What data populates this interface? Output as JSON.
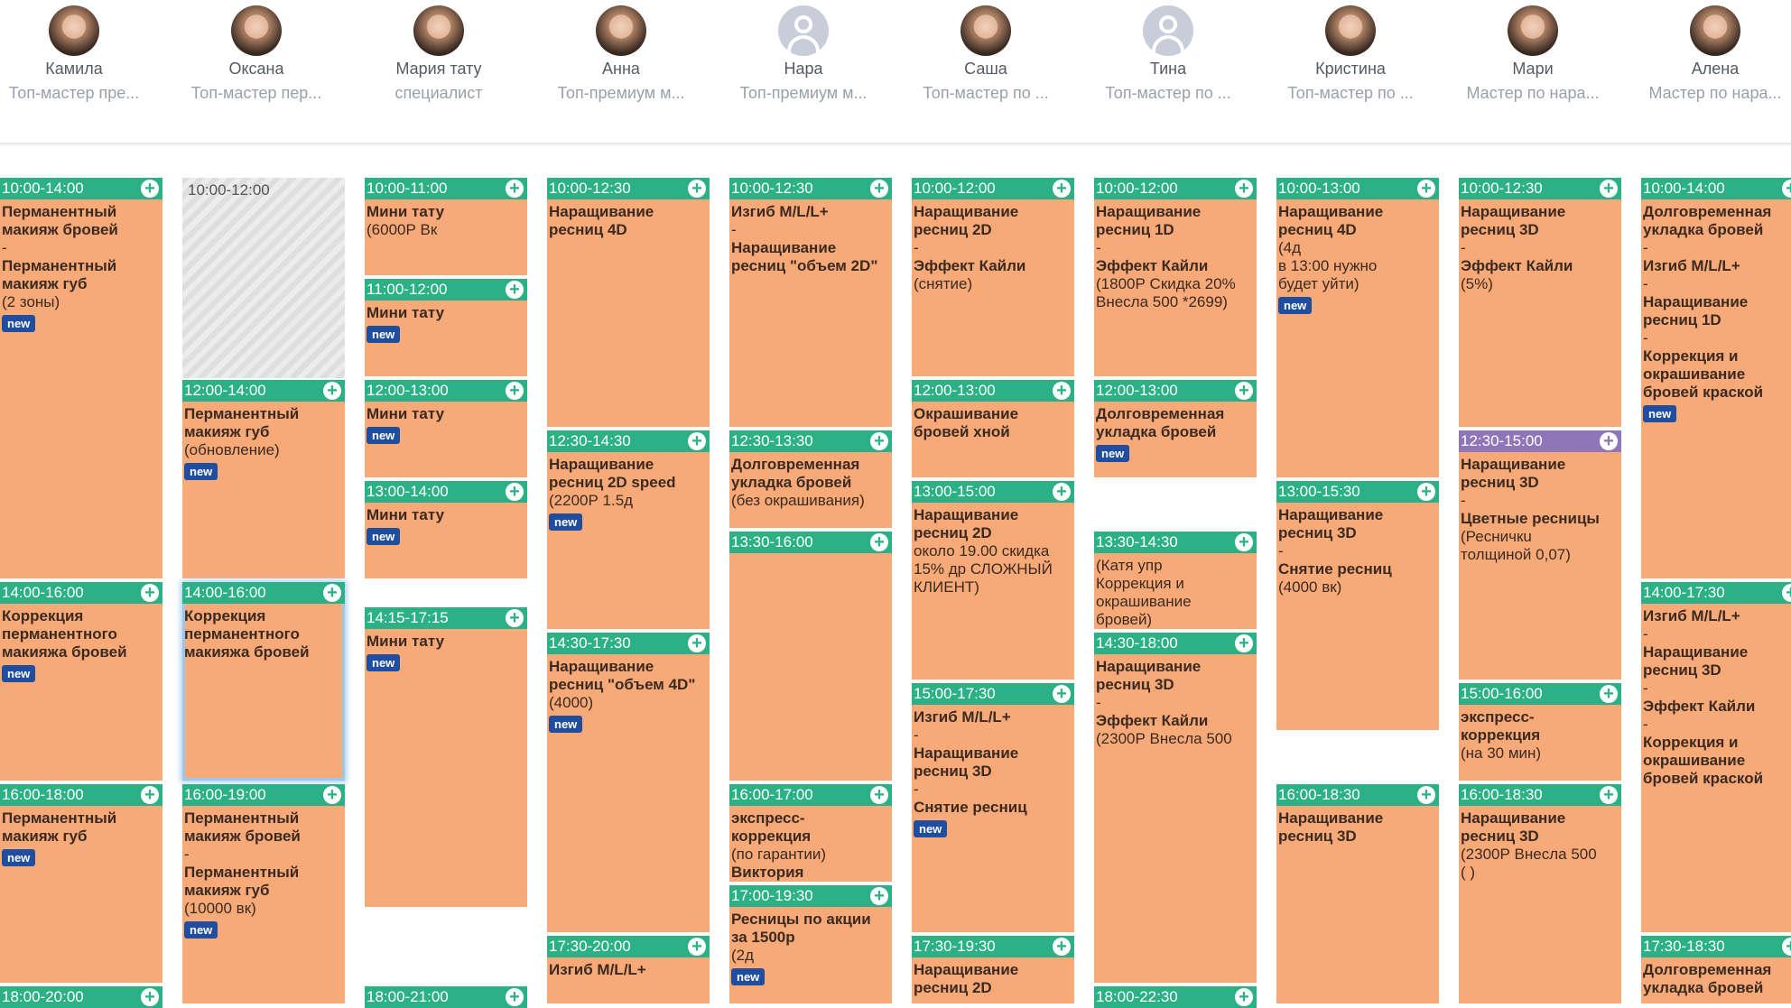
{
  "staff": [
    {
      "name": "Камила",
      "role": "Топ-мастер пре...",
      "avatar": "photo"
    },
    {
      "name": "Оксана",
      "role": "Топ-мастер пер...",
      "avatar": "photo"
    },
    {
      "name": "Мария тату",
      "role": "специалист",
      "avatar": "photo"
    },
    {
      "name": "Анна",
      "role": "Топ-премиум м...",
      "avatar": "photo"
    },
    {
      "name": "Нара",
      "role": "Топ-премиум м...",
      "avatar": "placeholder"
    },
    {
      "name": "Саша",
      "role": "Топ-мастер по ...",
      "avatar": "photo"
    },
    {
      "name": "Тина",
      "role": "Топ-мастер по ...",
      "avatar": "placeholder"
    },
    {
      "name": "Кристина",
      "role": "Топ-мастер по ...",
      "avatar": "photo"
    },
    {
      "name": "Мари",
      "role": "Мастер по нара...",
      "avatar": "photo"
    },
    {
      "name": "Алена",
      "role": "Мастер по нара...",
      "avatar": "photo"
    }
  ],
  "new_label": "new",
  "add_symbol": "+",
  "blank_slot": {
    "col": 1,
    "time": "10:00-12:00"
  },
  "appointments": [
    {
      "col": 0,
      "time": "10:00-14:00",
      "lines": [
        [
          "Перманентный",
          "b"
        ],
        [
          "макияж бровей",
          "b"
        ],
        [
          "-",
          ""
        ],
        [
          "Перманентный",
          "b"
        ],
        [
          "макияж губ",
          "b"
        ],
        [
          "(2 зоны)",
          ""
        ]
      ],
      "new": true
    },
    {
      "col": 0,
      "time": "14:00-16:00",
      "lines": [
        [
          "Коррекция",
          "b"
        ],
        [
          "перманентного",
          "b"
        ],
        [
          "макияжа бровей",
          "b"
        ]
      ],
      "new": true
    },
    {
      "col": 0,
      "time": "16:00-18:00",
      "lines": [
        [
          "Перманентный",
          "b"
        ],
        [
          "макияж губ",
          "b"
        ]
      ],
      "new": true
    },
    {
      "col": 0,
      "time": "18:00-20:00",
      "lines": [],
      "new": false
    },
    {
      "col": 1,
      "time": "12:00-14:00",
      "lines": [
        [
          "Перманентный",
          "b"
        ],
        [
          "макияж губ",
          "b"
        ],
        [
          "(обновление)",
          ""
        ]
      ],
      "new": true
    },
    {
      "col": 1,
      "time": "14:00-16:00",
      "lines": [
        [
          "Коррекция",
          "b"
        ],
        [
          "перманентного",
          "b"
        ],
        [
          "макияжа бровей",
          "b"
        ]
      ],
      "new": false,
      "selected": true
    },
    {
      "col": 1,
      "time": "16:00-19:00",
      "lines": [
        [
          "Перманентный",
          "b"
        ],
        [
          "макияж бровей",
          "b"
        ],
        [
          "-",
          ""
        ],
        [
          "Перманентный",
          "b"
        ],
        [
          "макияж губ",
          "b"
        ],
        [
          "(10000 вк)",
          ""
        ]
      ],
      "new": true
    },
    {
      "col": 2,
      "time": "10:00-11:00",
      "lines": [
        [
          "Мини тату",
          "b"
        ],
        [
          "(6000Р Вк",
          ""
        ]
      ],
      "new": false
    },
    {
      "col": 2,
      "time": "11:00-12:00",
      "lines": [
        [
          "Мини тату",
          "b"
        ]
      ],
      "new": true
    },
    {
      "col": 2,
      "time": "12:00-13:00",
      "lines": [
        [
          "Мини тату",
          "b"
        ]
      ],
      "new": true
    },
    {
      "col": 2,
      "time": "13:00-14:00",
      "lines": [
        [
          "Мини тату",
          "b"
        ]
      ],
      "new": true
    },
    {
      "col": 2,
      "time": "14:15-17:15",
      "lines": [
        [
          "Мини тату",
          "b"
        ]
      ],
      "new": true
    },
    {
      "col": 2,
      "time": "18:00-21:00",
      "lines": [],
      "new": false
    },
    {
      "col": 3,
      "time": "10:00-12:30",
      "lines": [
        [
          "Наращивание",
          "b"
        ],
        [
          "ресниц 4D",
          "b"
        ]
      ],
      "new": false
    },
    {
      "col": 3,
      "time": "12:30-14:30",
      "lines": [
        [
          "Наращивание",
          "b"
        ],
        [
          "ресниц 2D speed",
          "b"
        ],
        [
          "(2200Р 1.5д",
          ""
        ]
      ],
      "new": true
    },
    {
      "col": 3,
      "time": "14:30-17:30",
      "lines": [
        [
          "Наращивание",
          "b"
        ],
        [
          "ресниц \"объем 4D\"",
          "b"
        ],
        [
          "(4000)",
          ""
        ]
      ],
      "new": true
    },
    {
      "col": 3,
      "time": "17:30-20:00",
      "lines": [
        [
          "Изгиб M/L/L+",
          "b"
        ]
      ],
      "new": false
    },
    {
      "col": 4,
      "time": "10:00-12:30",
      "lines": [
        [
          "Изгиб M/L/L+",
          "b"
        ],
        [
          "-",
          ""
        ],
        [
          "Наращивание",
          "b"
        ],
        [
          "ресниц \"объем 2D\"",
          "b"
        ]
      ],
      "new": false
    },
    {
      "col": 4,
      "time": "12:30-13:30",
      "lines": [
        [
          "Долговременная",
          "b"
        ],
        [
          "укладка бровей",
          "b"
        ],
        [
          "(без окрашивания)",
          ""
        ]
      ],
      "new": false
    },
    {
      "col": 4,
      "time": "13:30-16:00",
      "lines": [],
      "new": false
    },
    {
      "col": 4,
      "time": "16:00-17:00",
      "lines": [
        [
          "экспресс-",
          "b"
        ],
        [
          "коррекция",
          "b"
        ],
        [
          "(по гарантии)",
          ""
        ],
        [
          "Виктория",
          "b"
        ]
      ],
      "new": false
    },
    {
      "col": 4,
      "time": "17:00-19:30",
      "lines": [
        [
          "Ресницы по акции",
          "b"
        ],
        [
          "за 1500р",
          "b"
        ],
        [
          "(2д",
          ""
        ]
      ],
      "new": true
    },
    {
      "col": 5,
      "time": "10:00-12:00",
      "lines": [
        [
          "Наращивание",
          "b"
        ],
        [
          "ресниц 2D",
          "b"
        ],
        [
          "-",
          ""
        ],
        [
          "Эффект Кайли",
          "b"
        ],
        [
          "(снятие)",
          ""
        ]
      ],
      "new": false
    },
    {
      "col": 5,
      "time": "12:00-13:00",
      "lines": [
        [
          "Окрашивание",
          "b"
        ],
        [
          "бровей хной",
          "b"
        ]
      ],
      "new": false
    },
    {
      "col": 5,
      "time": "13:00-15:00",
      "lines": [
        [
          "Наращивание",
          "b"
        ],
        [
          "ресниц 2D",
          "b"
        ],
        [
          " ",
          ""
        ],
        [
          "около 19.00 скидка",
          ""
        ],
        [
          "15% др СЛОЖНЫЙ",
          ""
        ],
        [
          "КЛИЕНТ)",
          ""
        ]
      ],
      "new": false
    },
    {
      "col": 5,
      "time": "15:00-17:30",
      "lines": [
        [
          "Изгиб M/L/L+",
          "b"
        ],
        [
          "-",
          ""
        ],
        [
          "Наращивание",
          "b"
        ],
        [
          "ресниц 3D",
          "b"
        ],
        [
          "-",
          ""
        ],
        [
          "Снятие ресниц",
          "b"
        ]
      ],
      "new": true
    },
    {
      "col": 5,
      "time": "17:30-19:30",
      "lines": [
        [
          "Наращивание",
          "b"
        ],
        [
          "ресниц 2D",
          "b"
        ]
      ],
      "new": false
    },
    {
      "col": 6,
      "time": "10:00-12:00",
      "lines": [
        [
          "Наращивание",
          "b"
        ],
        [
          "ресниц 1D",
          "b"
        ],
        [
          "-",
          ""
        ],
        [
          "Эффект Кайли",
          "b"
        ],
        [
          "(1800Р Скидка 20%",
          ""
        ],
        [
          " ",
          ""
        ],
        [
          "Внесла 500 *2699)",
          ""
        ]
      ],
      "new": false
    },
    {
      "col": 6,
      "time": "12:00-13:00",
      "lines": [
        [
          "Долговременная",
          "b"
        ],
        [
          "укладка бровей",
          "b"
        ]
      ],
      "new": true
    },
    {
      "col": 6,
      "time": "13:30-14:30",
      "lines": [
        [
          "(Катя упр",
          ""
        ],
        [
          "Коррекция и",
          ""
        ],
        [
          "окрашивание",
          ""
        ],
        [
          "бровей)",
          ""
        ]
      ],
      "new": false
    },
    {
      "col": 6,
      "time": "14:30-18:00",
      "lines": [
        [
          "Наращивание",
          "b"
        ],
        [
          "ресниц 3D",
          "b"
        ],
        [
          "-",
          ""
        ],
        [
          "Эффект Кайли",
          "b"
        ],
        [
          "(2300Р Внесла 500",
          ""
        ]
      ],
      "new": false
    },
    {
      "col": 6,
      "time": "18:00-22:30",
      "lines": [],
      "new": false
    },
    {
      "col": 7,
      "time": "10:00-13:00",
      "lines": [
        [
          "Наращивание",
          "b"
        ],
        [
          "ресниц 4D",
          "b"
        ],
        [
          "(4д",
          ""
        ],
        [
          " ",
          ""
        ],
        [
          "в 13:00 нужно",
          ""
        ],
        [
          "будет уйти)",
          ""
        ]
      ],
      "new": true
    },
    {
      "col": 7,
      "time": "13:00-15:30",
      "lines": [
        [
          "Наращивание",
          "b"
        ],
        [
          "ресниц 3D",
          "b"
        ],
        [
          "-",
          ""
        ],
        [
          "Снятие ресниц",
          "b"
        ],
        [
          "(4000 вк)",
          ""
        ]
      ],
      "new": false
    },
    {
      "col": 7,
      "time": "16:00-18:30",
      "lines": [
        [
          "Наращивание",
          "b"
        ],
        [
          "ресниц 3D",
          "b"
        ]
      ],
      "new": false
    },
    {
      "col": 8,
      "time": "10:00-12:30",
      "lines": [
        [
          "Наращивание",
          "b"
        ],
        [
          "ресниц 3D",
          "b"
        ],
        [
          "-",
          ""
        ],
        [
          "Эффект Кайли",
          "b"
        ],
        [
          "(5%)",
          ""
        ]
      ],
      "new": false
    },
    {
      "col": 8,
      "time": "12:30-15:00",
      "lines": [
        [
          "Наращивание",
          "b"
        ],
        [
          "ресниц 3D",
          "b"
        ],
        [
          "-",
          ""
        ],
        [
          "Цветные ресницы",
          "b"
        ],
        [
          "(Ресничкu",
          ""
        ],
        [
          "толщиной 0,07)",
          ""
        ]
      ],
      "new": false,
      "purple": true
    },
    {
      "col": 8,
      "time": "15:00-16:00",
      "lines": [
        [
          "экспресс-",
          "b"
        ],
        [
          "коррекция",
          "b"
        ],
        [
          "(на 30 мин)",
          ""
        ]
      ],
      "new": false
    },
    {
      "col": 8,
      "time": "16:00-18:30",
      "lines": [
        [
          "Наращивание",
          "b"
        ],
        [
          "ресниц 3D",
          "b"
        ],
        [
          "(2300Р Внесла 500",
          ""
        ],
        [
          "(                    )",
          ""
        ]
      ],
      "new": false
    },
    {
      "col": 9,
      "time": "10:00-14:00",
      "lines": [
        [
          "Долговременная",
          "b"
        ],
        [
          "укладка бровей",
          "b"
        ],
        [
          "-",
          ""
        ],
        [
          "Изгиб M/L/L+",
          "b"
        ],
        [
          "-",
          ""
        ],
        [
          "Наращивание",
          "b"
        ],
        [
          "ресниц 1D",
          "b"
        ],
        [
          "-",
          ""
        ],
        [
          "Коррекция и",
          "b"
        ],
        [
          "окрашивание",
          "b"
        ],
        [
          "бровей краской",
          "b"
        ]
      ],
      "new": true
    },
    {
      "col": 9,
      "time": "14:00-17:30",
      "lines": [
        [
          "Изгиб M/L/L+",
          "b"
        ],
        [
          "-",
          ""
        ],
        [
          "Наращивание",
          "b"
        ],
        [
          "ресниц 3D",
          "b"
        ],
        [
          "-",
          ""
        ],
        [
          "Эффект Кайли",
          "b"
        ],
        [
          "-",
          ""
        ],
        [
          "Коррекция и",
          "b"
        ],
        [
          "окрашивание",
          "b"
        ],
        [
          "бровей краской",
          "b"
        ]
      ],
      "new": false
    },
    {
      "col": 9,
      "time": "17:30-18:30",
      "lines": [
        [
          "Долговременная",
          "b"
        ],
        [
          "укладка бровей",
          "b"
        ]
      ],
      "new": false
    }
  ]
}
